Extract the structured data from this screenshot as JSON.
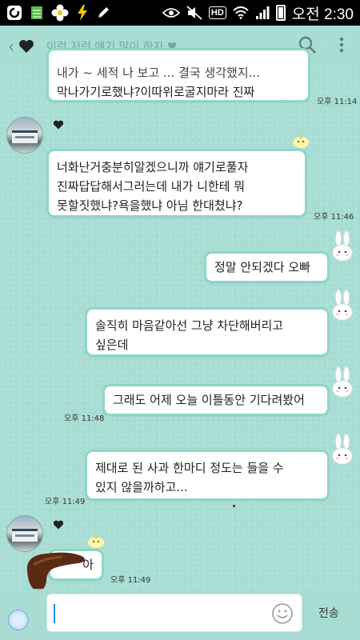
{
  "status_bar": {
    "time": "오전 2:30",
    "hd_label": "HD"
  },
  "app_bar": {
    "title": "이런 저런 얘기 많이 하자 ♥",
    "back_icon": "chevron-left-icon",
    "search_icon": "search-icon",
    "more_icon": "more-vertical-icon"
  },
  "messages": [
    {
      "id": "m0",
      "from": "other",
      "text_line1": "내가 ~ 세적 나 보고 ... 결국 생각했지...",
      "text_line2": "막나가기로했냐?이따위로굴지마라 진짜",
      "time": "오후 11:14"
    },
    {
      "id": "m1",
      "from": "other",
      "text_line1": "너화난거충분히알겠으니까 얘기로풀자",
      "text_line2": "진짜답답해서그러는데 내가 니한테 뭐",
      "text_line3": "못할짓했냐?욕을했냐  아님 한대쳤냐?",
      "time": "오후 11:46"
    },
    {
      "id": "m2",
      "from": "me",
      "text_line1": "정말 안되겠다 오빠"
    },
    {
      "id": "m3",
      "from": "me",
      "text_line1": "솔직히 마음같아선 그냥 차단해버리고",
      "text_line2": "싶은데"
    },
    {
      "id": "m4",
      "from": "me",
      "text_line1": "그래도 어제 오늘 이틀동안 기다려봤어",
      "time": "오후 11:48"
    },
    {
      "id": "m5",
      "from": "me",
      "text_line1": "제대로 된 사과 한마디 정도는 들을 수",
      "text_line2": "있지 않을까하고...",
      "time": "오후 11:49"
    },
    {
      "id": "m6",
      "from": "other",
      "text_line1": "아",
      "time": "오후 11:49"
    }
  ],
  "input": {
    "value": "",
    "send_label": "전송"
  },
  "colors": {
    "background": "#a8ddd4",
    "bubble_border": "#8ed6c6",
    "bubble_fill": "#ffffff"
  }
}
